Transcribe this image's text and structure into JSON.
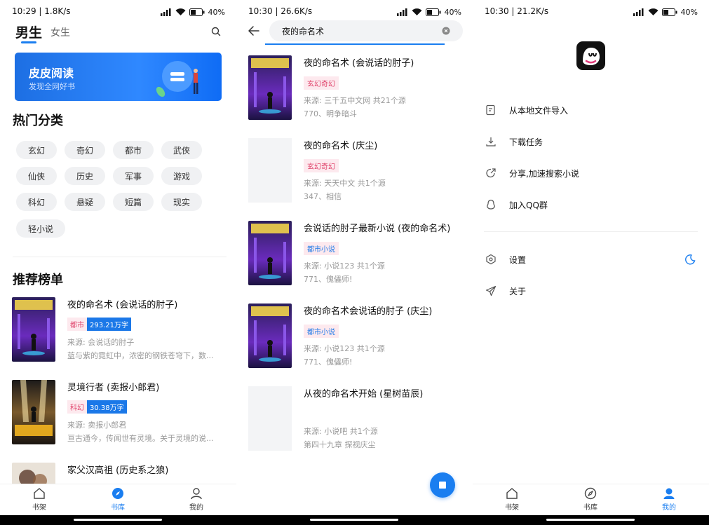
{
  "colors": {
    "accent": "#1a7ef0",
    "tag_pink_bg": "#fde9ee",
    "tag_pink_text": "#e0436b"
  },
  "panel1": {
    "status": {
      "time": "10:29 | 1.8K/s",
      "battery": "40"
    },
    "tabs": {
      "boy": "男生",
      "girl": "女生"
    },
    "banner": {
      "title": "皮皮阅读",
      "subtitle": "发现全网好书"
    },
    "hot_title": "热门分类",
    "categories": [
      "玄幻",
      "奇幻",
      "都市",
      "武侠",
      "仙侠",
      "历史",
      "军事",
      "游戏",
      "科幻",
      "悬疑",
      "短篇",
      "现实",
      "轻小说"
    ],
    "rank_title": "推荐榜单",
    "ranks": [
      {
        "title": "夜的命名术 (会说话的肘子)",
        "tag": "都市",
        "words": "293.21万字",
        "source": "来源: 会说话的肘子",
        "desc": "蓝与紫的霓虹中，浓密的钢铁苍穹下，数..."
      },
      {
        "title": "灵境行者 (卖报小郎君)",
        "tag": "科幻",
        "words": "30.38万字",
        "source": "来源: 卖报小郎君",
        "desc": "亘古通今，传闻世有灵境。关于灵境的说..."
      },
      {
        "title": "家父汉高祖 (历史系之狼)"
      }
    ],
    "nav": {
      "shelf": "书架",
      "library": "书库",
      "mine": "我的"
    }
  },
  "panel2": {
    "status": {
      "time": "10:30 | 26.6K/s",
      "battery": "40"
    },
    "search": {
      "value": "夜的命名术"
    },
    "results": [
      {
        "title": "夜的命名术 (会说话的肘子)",
        "tag": "玄幻奇幻",
        "source": "来源: 三千五中文网 共21个源",
        "latest": "770、明争暗斗"
      },
      {
        "title": "夜的命名术 (庆尘)",
        "tag": "玄幻奇幻",
        "source": "来源: 天天中文 共1个源",
        "latest": "347、相信"
      },
      {
        "title": "会说话的肘子最新小说 (夜的命名术)",
        "tag": "都市小说",
        "source": "来源: 小说123 共1个源",
        "latest": "771、傀儡师!"
      },
      {
        "title": "夜的命名术会说话的肘子 (庆尘)",
        "tag": "都市小说",
        "source": "来源: 小说123 共1个源",
        "latest": "771、傀儡师!"
      },
      {
        "title": "从夜的命名术开始 (星树苗辰)",
        "source": "来源: 小说吧 共1个源",
        "latest": "第四十九章 探视庆尘"
      }
    ]
  },
  "panel3": {
    "status": {
      "time": "10:30 | 21.2K/s",
      "battery": "40"
    },
    "menu": {
      "import": "从本地文件导入",
      "download": "下载任务",
      "share": "分享,加速搜索小说",
      "qq": "加入QQ群",
      "settings": "设置",
      "about": "关于"
    },
    "nav": {
      "shelf": "书架",
      "library": "书库",
      "mine": "我的"
    }
  }
}
